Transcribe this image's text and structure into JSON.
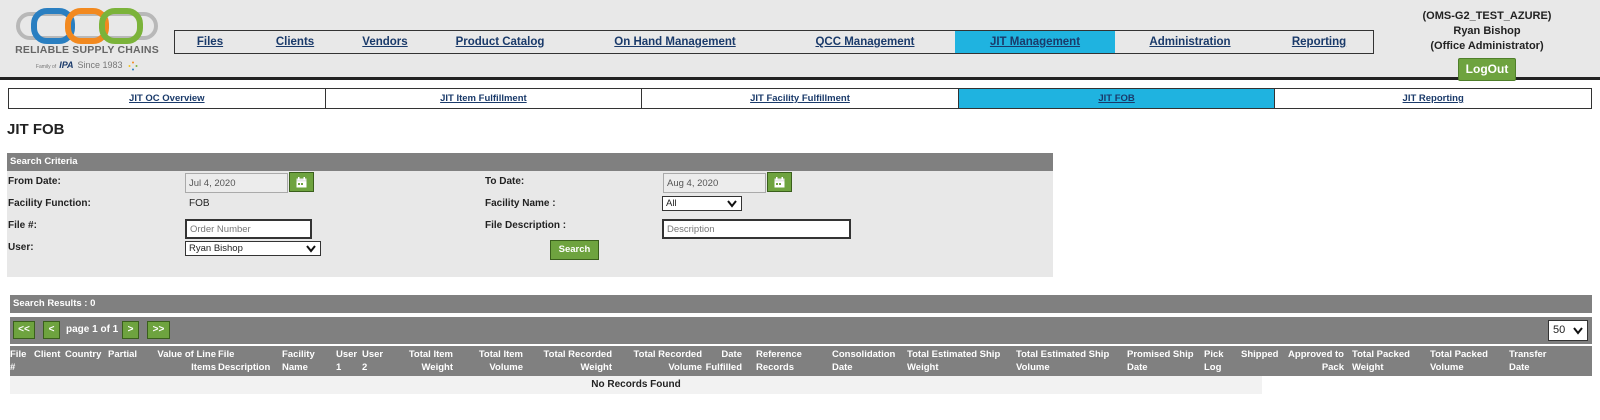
{
  "header": {
    "logo": {
      "brand": "RELIABLE SUPPLY CHAINS",
      "prefix": "Family of",
      "partner": "IPA",
      "since": "Since 1983",
      "colors": [
        "#2a7fc1",
        "#f2891f",
        "#7bb33a",
        "#b0b0b0"
      ]
    },
    "nav": [
      {
        "label": "Files",
        "active": false
      },
      {
        "label": "Clients",
        "active": false
      },
      {
        "label": "Vendors",
        "active": false
      },
      {
        "label": "Product Catalog",
        "active": false
      },
      {
        "label": "On Hand Management",
        "active": false
      },
      {
        "label": "QCC Management",
        "active": false
      },
      {
        "label": "JIT Management",
        "active": true
      },
      {
        "label": "Administration",
        "active": false
      },
      {
        "label": "Reporting",
        "active": false
      }
    ],
    "user": {
      "environment": "(OMS-G2_TEST_AZURE)",
      "name": "Ryan Bishop",
      "role": "(Office Administrator)",
      "logout_label": "LogOut"
    }
  },
  "subnav": [
    {
      "label": "JIT OC Overview",
      "active": false
    },
    {
      "label": "JIT Item Fulfillment",
      "active": false
    },
    {
      "label": "JIT Facility Fulfillment",
      "active": false
    },
    {
      "label": "JIT FOB",
      "active": true
    },
    {
      "label": "JIT Reporting",
      "active": false
    }
  ],
  "page_title": "JIT FOB",
  "criteria": {
    "title": "Search Criteria",
    "from_date_label": "From Date:",
    "from_date_value": "Jul 4, 2020",
    "to_date_label": "To Date:",
    "to_date_value": "Aug 4, 2020",
    "facility_function_label": "Facility Function:",
    "facility_function_value": "FOB",
    "facility_name_label": "Facility Name :",
    "facility_name_value": "All",
    "file_no_label": "File #:",
    "file_no_placeholder": "Order Number",
    "file_desc_label": "File Description :",
    "file_desc_placeholder": "Description",
    "user_label": "User:",
    "user_value": "Ryan Bishop",
    "search_label": "Search"
  },
  "results": {
    "title": "Search Results : 0",
    "pager": {
      "first": "<<",
      "prev": "<",
      "page_label": "page 1 of 1",
      "next": ">",
      "last": ">>",
      "page_size": "50"
    },
    "columns": [
      "File #",
      "Client",
      "Country",
      "Partial",
      "Value of Line Items",
      "File Description",
      "Facility Name",
      "User 1",
      "User 2",
      "Total Item Weight",
      "Total Item Volume",
      "Total Recorded Weight",
      "Total Recorded Volume",
      "Date Fulfilled",
      "Reference Records",
      "Consolidation Date",
      "Total Estimated Ship Weight",
      "Total Estimated Ship Volume",
      "Promised Ship Date",
      "Pick Log",
      "Shipped",
      "Approved to Pack",
      "Total Packed Weight",
      "Total Packed Volume",
      "Transfer Date"
    ],
    "empty_message": "No Records Found"
  }
}
